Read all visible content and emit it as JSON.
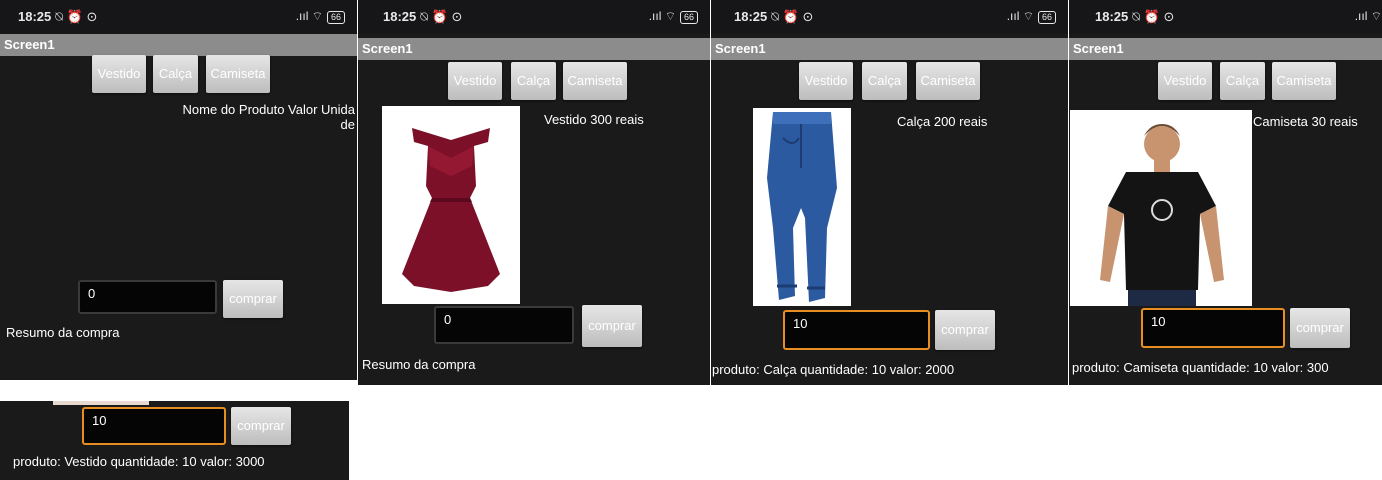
{
  "status": {
    "time": "18:25",
    "icons": "⍉ ⏰ ⊙",
    "signal": ".ııl ⌔",
    "battery": "66"
  },
  "screen_title": "Screen1",
  "buttons": {
    "vestido": "Vestido",
    "calca": "Calça",
    "camiseta": "Camiseta",
    "comprar": "comprar"
  },
  "panels": [
    {
      "header": "Nome do Produto  Valor  Unida\nde",
      "quantity": "0",
      "summary": "Resumo da compra"
    },
    {
      "product": "Vestido 300  reais",
      "quantity": "0",
      "summary": "Resumo da compra"
    },
    {
      "product": "Calça 200  reais",
      "quantity": "10",
      "summary": "produto: Calça quantidade: 10 valor: 2000"
    },
    {
      "product": "Camiseta 30  reais",
      "quantity": "10",
      "summary": "produto: Camiseta quantidade: 10 valor: 300"
    },
    {
      "quantity": "10",
      "summary": "produto: Vestido quantidade: 10 valor: 3000"
    }
  ],
  "images": [
    "dress-photo",
    "jeans-photo",
    "tshirt-photo"
  ]
}
